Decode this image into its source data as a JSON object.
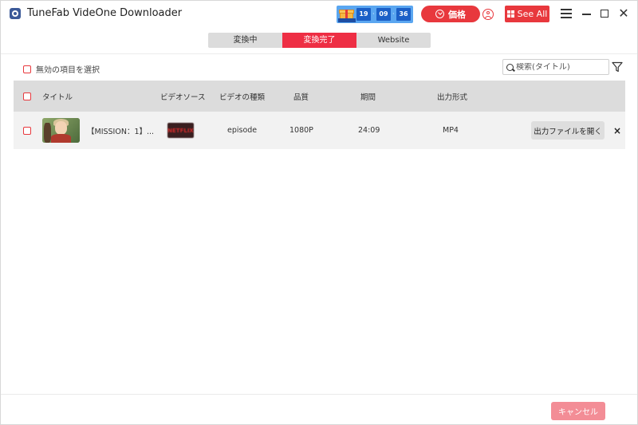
{
  "app": {
    "title": "TuneFab VideOne Downloader"
  },
  "promo": {
    "hours": "19",
    "minutes": "09",
    "seconds": "36",
    "sep": "·"
  },
  "header": {
    "price_label": "価格",
    "see_all_label": "See All"
  },
  "tabs": [
    {
      "label": "変換中"
    },
    {
      "label": "変換完了",
      "active": true
    },
    {
      "label": "Website"
    }
  ],
  "toolbar": {
    "select_invalid_label": "無効の項目を選択",
    "search_placeholder": "検索(タイトル)"
  },
  "table": {
    "headers": {
      "title": "タイトル",
      "video_source": "ビデオソース",
      "video_type": "ビデオの種類",
      "quality": "品質",
      "duration": "期間",
      "output_format": "出力形式"
    },
    "rows": [
      {
        "title": "【MISSION：1】...",
        "source": "NETFLIX",
        "video_type": "episode",
        "quality": "1080P",
        "duration": "24:09",
        "format": "MP4",
        "open_label": "出力ファイルを開く",
        "remove_label": "×"
      }
    ]
  },
  "footer": {
    "cancel_label": "キャンセル"
  },
  "colors": {
    "accent": "#ee2e44",
    "header_bg": "#dcdcdc",
    "row_bg": "#f2f2f2"
  }
}
